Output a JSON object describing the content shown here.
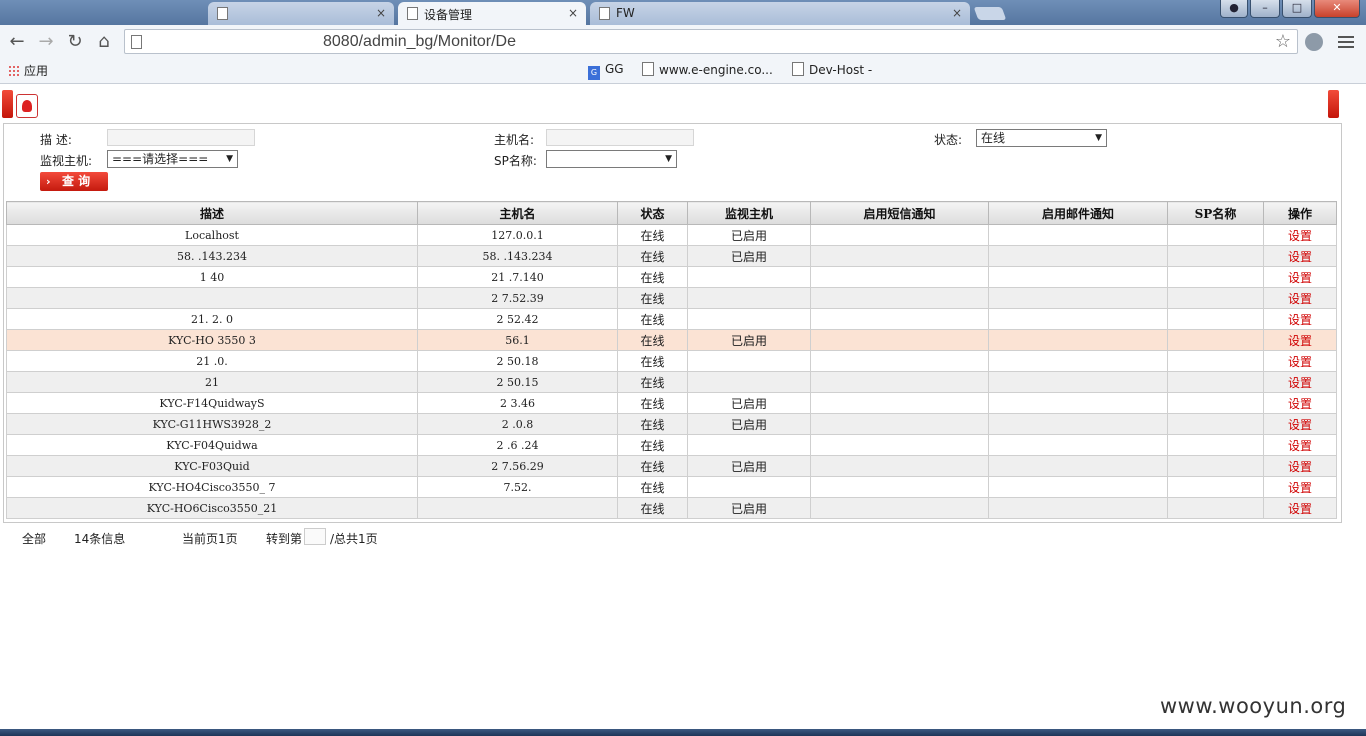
{
  "browser": {
    "tabs": [
      {
        "label": "",
        "active": false
      },
      {
        "label": "设备管理",
        "active": true
      },
      {
        "label": "FW",
        "active": false
      }
    ],
    "tab_close_glyph": "×",
    "url": "8080/admin_bg/Monitor/De",
    "bookmarks": [
      "应用",
      "GG",
      "www.e-engine.co...",
      "Dev-Host -"
    ],
    "window_buttons": {
      "minimize": "–",
      "maximize": "□",
      "close": "✕"
    }
  },
  "filters": {
    "desc_label": "描      述:",
    "host_label": "主机名:",
    "status_label": "状态:",
    "status_value": "在线",
    "monitor_label": "监视主机:",
    "monitor_value": "===请选择===",
    "sp_label": "SP名称:",
    "sp_value": "",
    "query_label": "查 询"
  },
  "table": {
    "headers": [
      "描述",
      "主机名",
      "状态",
      "监视主机",
      "启用短信通知",
      "启用邮件通知",
      "SP名称",
      "操作"
    ],
    "rows": [
      {
        "desc": "Localhost",
        "host": "127.0.0.1",
        "status": "在线",
        "monitor": "已启用",
        "sms": "",
        "mail": "",
        "sp": "",
        "op": "设置"
      },
      {
        "desc": "58.  .143.234",
        "host": "58.   .143.234",
        "status": "在线",
        "monitor": "已启用",
        "sms": "",
        "mail": "",
        "sp": "",
        "op": "设置"
      },
      {
        "desc": "1    40",
        "host": "21   .7.140",
        "status": "在线",
        "monitor": "",
        "sms": "",
        "mail": "",
        "sp": "",
        "op": "设置"
      },
      {
        "desc": "",
        "host": "2    7.52.39",
        "status": "在线",
        "monitor": "",
        "sms": "",
        "mail": "",
        "sp": "",
        "op": "设置"
      },
      {
        "desc": "21.   2.  0",
        "host": "2     52.42",
        "status": "在线",
        "monitor": "",
        "sms": "",
        "mail": "",
        "sp": "",
        "op": "设置"
      },
      {
        "desc": "KYC-HO   3550  3",
        "host": "    56.1",
        "status": "在线",
        "monitor": "已启用",
        "sms": "",
        "mail": "",
        "sp": "",
        "op": "设置"
      },
      {
        "desc": "21   .0.",
        "host": "2    50.18",
        "status": "在线",
        "monitor": "",
        "sms": "",
        "mail": "",
        "sp": "",
        "op": "设置"
      },
      {
        "desc": "21",
        "host": "2    50.15",
        "status": "在线",
        "monitor": "",
        "sms": "",
        "mail": "",
        "sp": "",
        "op": "设置"
      },
      {
        "desc": "KYC-F14QuidwayS",
        "host": "2     3.46",
        "status": "在线",
        "monitor": "已启用",
        "sms": "",
        "mail": "",
        "sp": "",
        "op": "设置"
      },
      {
        "desc": "KYC-G11HWS3928_2",
        "host": "2    .0.8",
        "status": "在线",
        "monitor": "已启用",
        "sms": "",
        "mail": "",
        "sp": "",
        "op": "设置"
      },
      {
        "desc": "KYC-F04Quidwa",
        "host": "2     .6 .24",
        "status": "在线",
        "monitor": "",
        "sms": "",
        "mail": "",
        "sp": "",
        "op": "设置"
      },
      {
        "desc": "KYC-F03Quid",
        "host": "2    7.56.29",
        "status": "在线",
        "monitor": "已启用",
        "sms": "",
        "mail": "",
        "sp": "",
        "op": "设置"
      },
      {
        "desc": "KYC-HO4Cisco3550_     7",
        "host": "   7.52.",
        "status": "在线",
        "monitor": "",
        "sms": "",
        "mail": "",
        "sp": "",
        "op": "设置"
      },
      {
        "desc": "KYC-HO6Cisco3550_21",
        "host": "",
        "status": "在线",
        "monitor": "已启用",
        "sms": "",
        "mail": "",
        "sp": "",
        "op": "设置"
      }
    ]
  },
  "pager": {
    "all": "全部",
    "count": "14条信息",
    "current": "当前页1页",
    "goto": "转到第",
    "total": "/总共1页"
  },
  "watermark": "www.wooyun.org",
  "colors": {
    "accent_red": "#d00000",
    "highlight_row": "#fbe3d4"
  }
}
